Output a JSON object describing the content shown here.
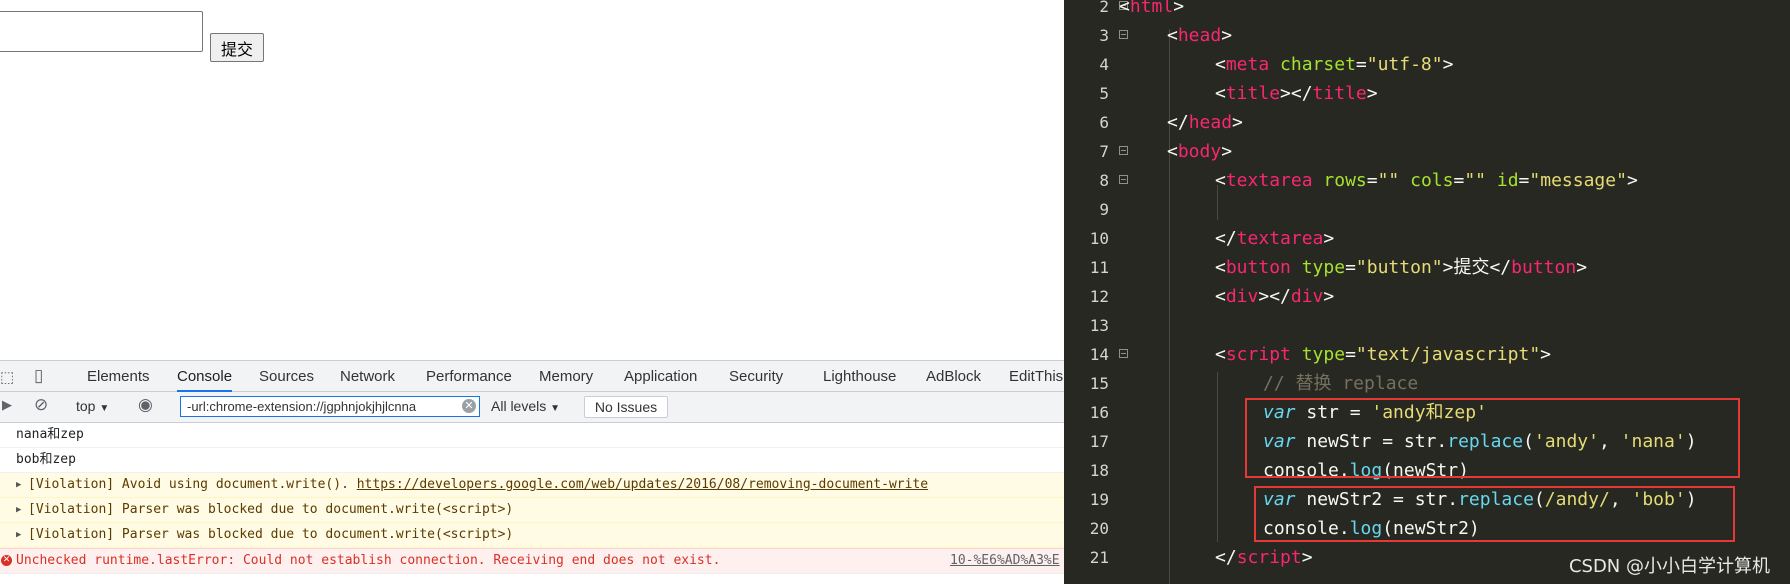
{
  "browser_page": {
    "textarea_value": "",
    "submit_button_label": "提交"
  },
  "devtools": {
    "tabs": [
      "Elements",
      "Console",
      "Sources",
      "Network",
      "Performance",
      "Memory",
      "Application",
      "Security",
      "Lighthouse",
      "AdBlock",
      "EditThis"
    ],
    "active_tab": "Console",
    "context_selector": "top",
    "filter_value": "-url:chrome-extension://jgphnjokjhjlcnna",
    "levels_label": "All levels",
    "issues_label": "No Issues",
    "messages": [
      {
        "type": "log",
        "text": "nana和zep"
      },
      {
        "type": "log",
        "text": "bob和zep"
      },
      {
        "type": "violation",
        "text": "[Violation] Avoid using document.write(). ",
        "link": "https://developers.google.com/web/updates/2016/08/removing-document-write"
      },
      {
        "type": "violation",
        "text": "[Violation] Parser was blocked due to document.write(<script>)"
      },
      {
        "type": "violation",
        "text": "[Violation] Parser was blocked due to document.write(<script>)"
      },
      {
        "type": "error",
        "text": "Unchecked runtime.lastError: Could not establish connection. Receiving end does not exist.",
        "source": "10-%E6%AD%A3%E"
      }
    ]
  },
  "editor": {
    "line_numbers": [
      "2",
      "3",
      "4",
      "5",
      "6",
      "7",
      "8",
      "9",
      "10",
      "11",
      "12",
      "13",
      "14",
      "15",
      "16",
      "17",
      "18",
      "19",
      "20",
      "21"
    ],
    "lines": {
      "l2": {
        "t": "html"
      },
      "l3": {
        "t": "head"
      },
      "l4": {
        "t": "meta",
        "a": "charset",
        "v": "\"utf-8\""
      },
      "l5": {
        "t": "title",
        "t2": "title"
      },
      "l6": {
        "t": "head"
      },
      "l7": {
        "t": "body"
      },
      "l8": {
        "t": "textarea",
        "a1": "rows",
        "v1": "\"\"",
        "a2": "cols",
        "v2": "\"\"",
        "a3": "id",
        "v3": "\"message\""
      },
      "l10": {
        "t": "textarea"
      },
      "l11": {
        "t": "button",
        "a": "type",
        "v": "\"button\"",
        "text": "提交",
        "t2": "button"
      },
      "l12": {
        "t": "div",
        "t2": "div"
      },
      "l14": {
        "t": "script",
        "a": "type",
        "v": "\"text/javascript\""
      },
      "l15": {
        "comment": "// 替换 replace"
      },
      "l16": {
        "kw": "var",
        "rest": " str = ",
        "str": "'andy和zep'"
      },
      "l17": {
        "kw": "var",
        "rest": " newStr = str.",
        "fn": "replace",
        "open": "(",
        "s1": "'andy'",
        "comma": ", ",
        "s2": "'nana'",
        "close": ")"
      },
      "l18": {
        "pre": "console.",
        "fn": "log",
        "args": "(newStr)"
      },
      "l19": {
        "kw": "var",
        "rest": " newStr2 = str.",
        "fn": "replace",
        "open": "(",
        "s1": "/andy/",
        "comma": ", ",
        "s2": "'bob'",
        "close": ")"
      },
      "l20": {
        "pre": "console.",
        "fn": "log",
        "args": "(newStr2)"
      },
      "l21": {
        "t": "script"
      }
    }
  },
  "watermark": "CSDN @小小白学计算机",
  "colors": {
    "tag": "#f92672",
    "attr": "#a6e22e",
    "string": "#e6db74",
    "keyword": "#66d9ef",
    "comment": "#75715e",
    "editor_bg": "#272822",
    "highlight_box": "#e53935"
  }
}
